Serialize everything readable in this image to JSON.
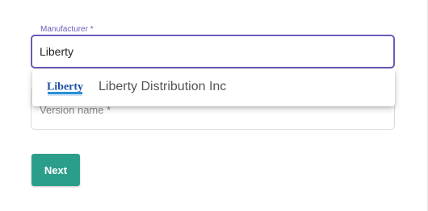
{
  "form": {
    "manufacturer": {
      "label": "Manufacturer *",
      "value": "Liberty",
      "accent_color": "#6a5cb8"
    },
    "version_name": {
      "placeholder": "Version name *"
    },
    "dropdown": {
      "options": [
        {
          "label": "Liberty Distribution Inc",
          "logo_text": "Liberty",
          "logo": "liberty-logo"
        }
      ]
    },
    "next_label": "Next",
    "next_color": "#2b9e8b"
  }
}
